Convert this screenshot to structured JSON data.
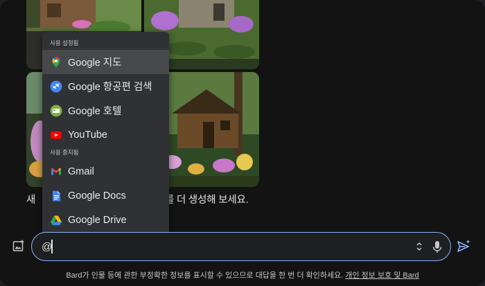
{
  "menu": {
    "section_enabled": "사용 설정됨",
    "section_disabled": "사용 중지됨",
    "items": [
      {
        "label": "Google 지도",
        "icon": "google-maps-icon",
        "active": true
      },
      {
        "label": "Google 항공편 검색",
        "icon": "google-flights-icon"
      },
      {
        "label": "Google 호텔",
        "icon": "google-hotels-icon"
      },
      {
        "label": "YouTube",
        "icon": "youtube-icon"
      },
      {
        "label": "Gmail",
        "icon": "gmail-icon"
      },
      {
        "label": "Google Docs",
        "icon": "google-docs-icon"
      },
      {
        "label": "Google Drive",
        "icon": "google-drive-icon"
      }
    ]
  },
  "caption": {
    "start": "새 ",
    "end": "를 더 생성해 보세요."
  },
  "input": {
    "value": "@",
    "placeholder": ""
  },
  "footer": {
    "disclaimer": "Bard가 인물 등에 관한 부정확한 정보를 표시할 수 있으므로 대답을 한 번 더 확인하세요.",
    "link": "개인 정보 보호 및 Bard"
  },
  "colors": {
    "accent": "#8ab4f8",
    "background": "#131314",
    "menu_bg": "#303134"
  }
}
